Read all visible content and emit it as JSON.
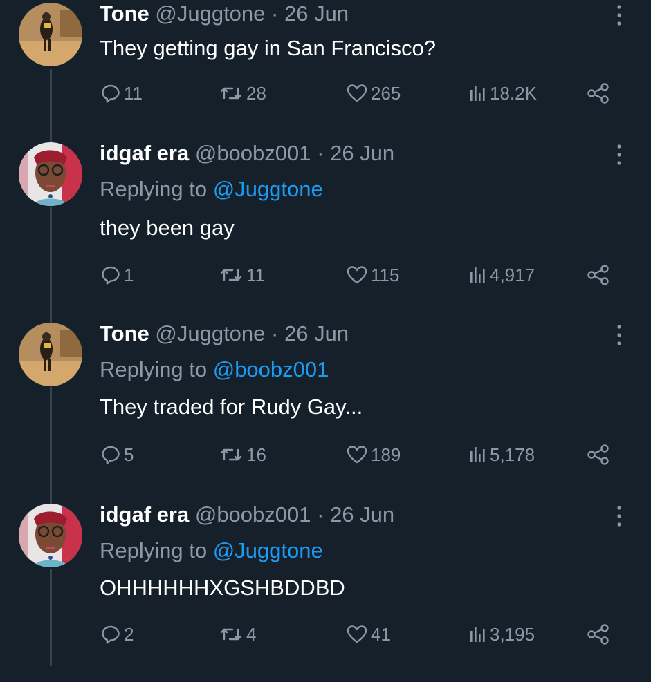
{
  "tweets": [
    {
      "display_name": "Tone",
      "handle": "@Juggtone",
      "separator": "·",
      "date": "26 Jun",
      "replying_prefix": "",
      "replying_to": "",
      "text": "They getting gay in San Francisco?",
      "replies": "11",
      "retweets": "28",
      "likes": "265",
      "views": "18.2K",
      "avatar": "tone-avatar"
    },
    {
      "display_name": "idgaf era",
      "handle": "@boobz001",
      "separator": "·",
      "date": "26 Jun",
      "replying_prefix": "Replying to",
      "replying_to": "@Juggtone",
      "text": "they been gay",
      "replies": "1",
      "retweets": "11",
      "likes": "115",
      "views": "4,917",
      "avatar": "idgaf-avatar"
    },
    {
      "display_name": "Tone",
      "handle": "@Juggtone",
      "separator": "·",
      "date": "26 Jun",
      "replying_prefix": "Replying to",
      "replying_to": "@boobz001",
      "text": "They traded for Rudy Gay...",
      "replies": "5",
      "retweets": "16",
      "likes": "189",
      "views": "5,178",
      "avatar": "tone-avatar"
    },
    {
      "display_name": "idgaf era",
      "handle": "@boobz001",
      "separator": "·",
      "date": "26 Jun",
      "replying_prefix": "Replying to",
      "replying_to": "@Juggtone",
      "text": "OHHHHHHXGSHBDDBD",
      "replies": "2",
      "retweets": "4",
      "likes": "41",
      "views": "3,195",
      "avatar": "idgaf-avatar"
    }
  ],
  "colors": {
    "background": "#15202b",
    "primary_text": "#ffffff",
    "secondary_text": "#8b98a5",
    "link": "#1d9bf0",
    "thread_line": "#38444d"
  },
  "icons": [
    "reply-icon",
    "retweet-icon",
    "like-icon",
    "views-icon",
    "share-icon",
    "more-icon"
  ]
}
